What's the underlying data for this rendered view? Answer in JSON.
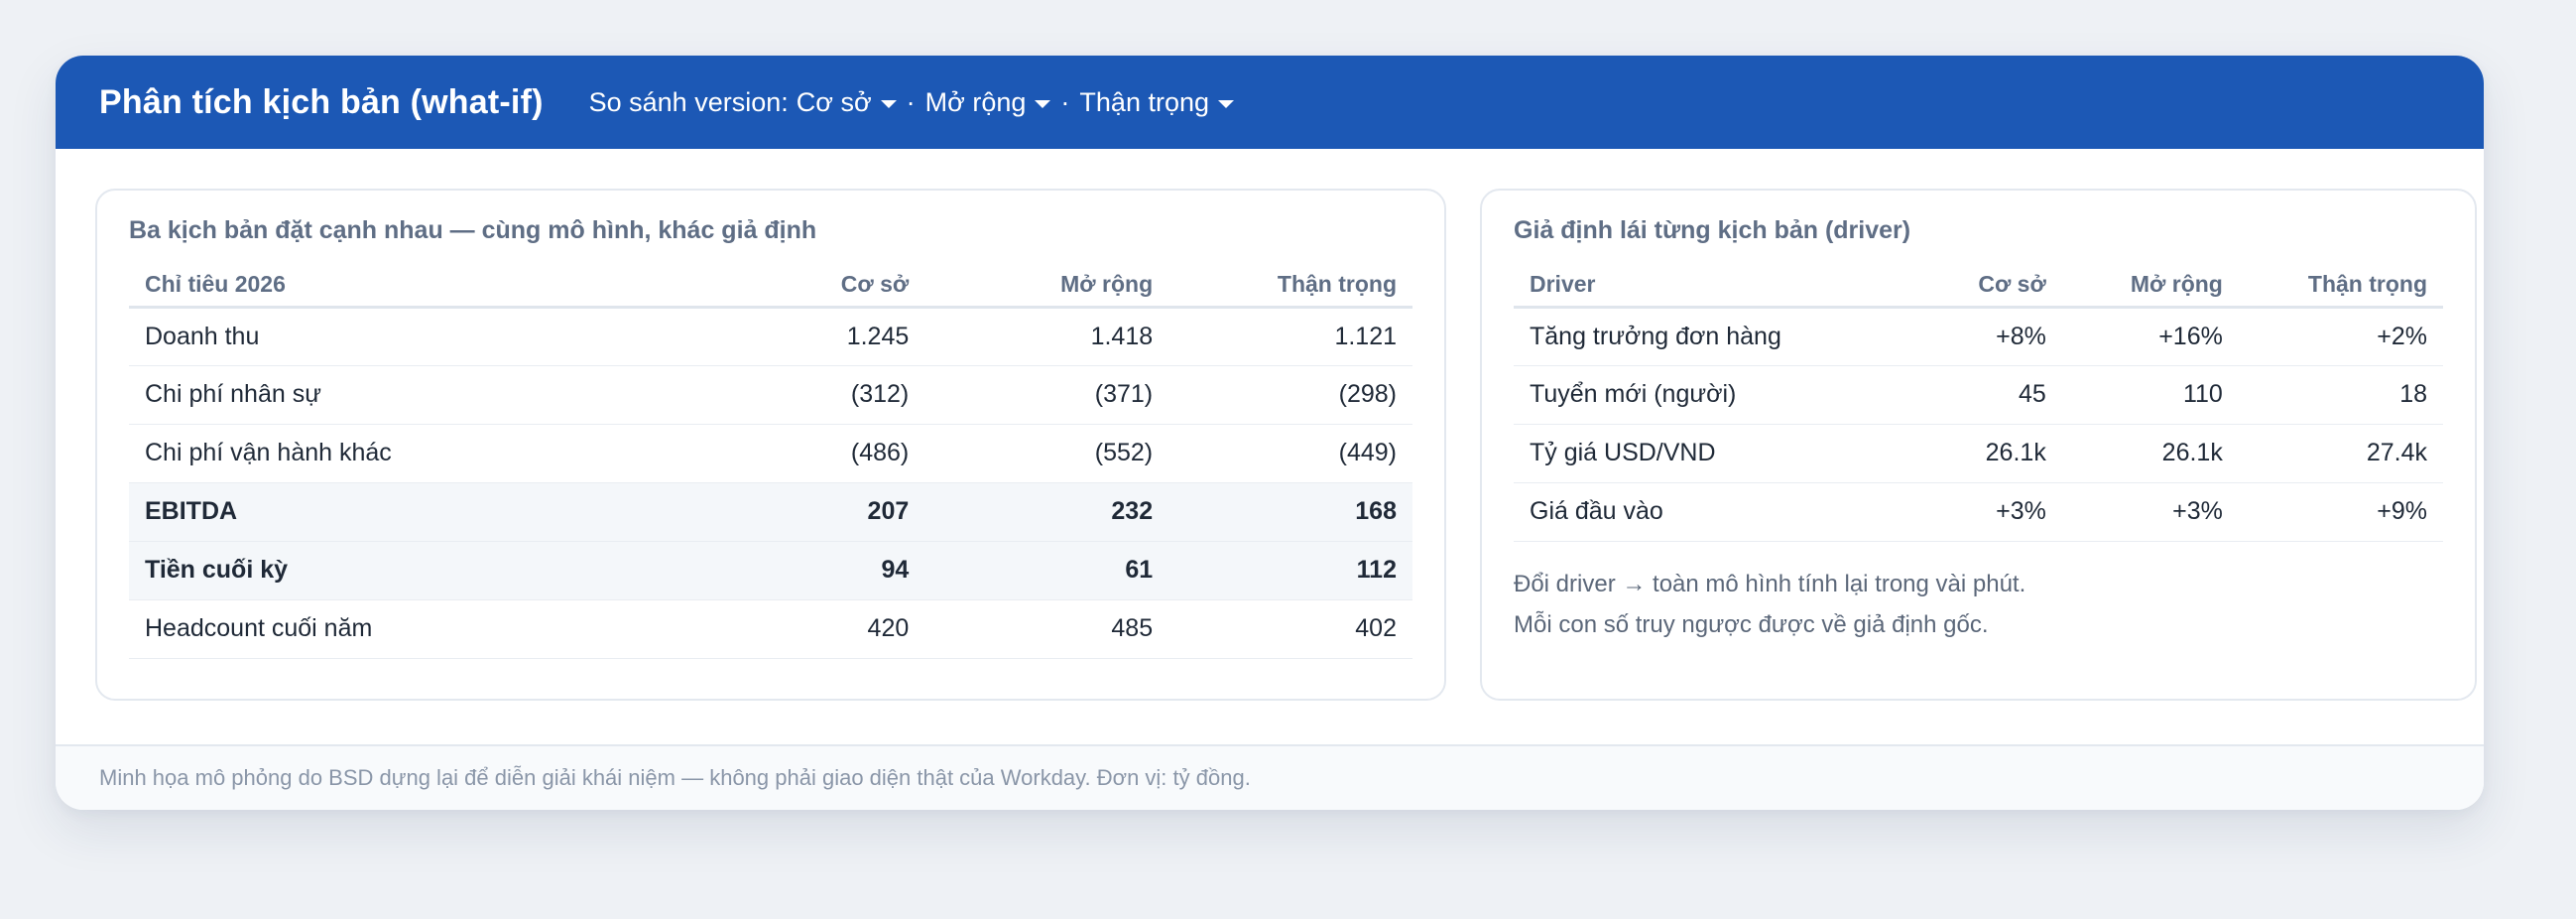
{
  "header": {
    "title": "Phân tích kịch bản (what-if)",
    "compare_label": "So sánh version:",
    "separator": "·",
    "versions": [
      "Cơ sở",
      "Mở rộng",
      "Thận trọng"
    ]
  },
  "scenario_table": {
    "title": "Ba kịch bản đặt cạnh nhau — cùng mô hình, khác giả định",
    "columns": [
      "Chỉ tiêu 2026",
      "Cơ sở",
      "Mở rộng",
      "Thận trọng"
    ],
    "rows": [
      {
        "label": "Doanh thu",
        "values": [
          "1.245",
          "1.418",
          "1.121"
        ],
        "bold": false
      },
      {
        "label": "Chi phí nhân sự",
        "values": [
          "(312)",
          "(371)",
          "(298)"
        ],
        "bold": false
      },
      {
        "label": "Chi phí vận hành khác",
        "values": [
          "(486)",
          "(552)",
          "(449)"
        ],
        "bold": false
      },
      {
        "label": "EBITDA",
        "values": [
          "207",
          "232",
          "168"
        ],
        "bold": true
      },
      {
        "label": "Tiền cuối kỳ",
        "values": [
          "94",
          "61",
          "112"
        ],
        "bold": true
      },
      {
        "label": "Headcount cuối năm",
        "values": [
          "420",
          "485",
          "402"
        ],
        "bold": false
      }
    ]
  },
  "driver_table": {
    "title": "Giả định lái từng kịch bản (driver)",
    "columns": [
      "Driver",
      "Cơ sở",
      "Mở rộng",
      "Thận trọng"
    ],
    "rows": [
      {
        "label": "Tăng trưởng đơn hàng",
        "values": [
          "+8%",
          "+16%",
          "+2%"
        ]
      },
      {
        "label": "Tuyển mới (người)",
        "values": [
          "45",
          "110",
          "18"
        ]
      },
      {
        "label": "Tỷ giá USD/VND",
        "values": [
          "26.1k",
          "26.1k",
          "27.4k"
        ]
      },
      {
        "label": "Giá đầu vào",
        "values": [
          "+3%",
          "+3%",
          "+9%"
        ]
      }
    ],
    "notes": [
      "Đổi driver → toàn mô hình tính lại trong vài phút.",
      "Mỗi con số truy ngược được về giả định gốc."
    ]
  },
  "footer": {
    "text": "Minh họa mô phỏng do BSD dựng lại để diễn giải khái niệm — không phải giao diện thật của Workday. Đơn vị: tỷ đồng."
  }
}
